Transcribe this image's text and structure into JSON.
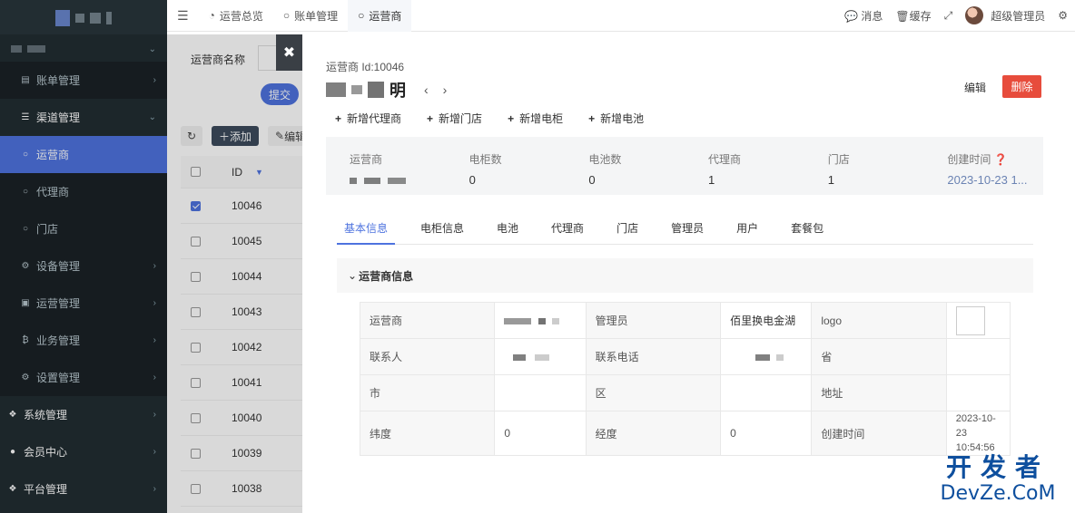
{
  "sidebar": {
    "items": [
      {
        "label": "账单管理",
        "icon": "file-icon",
        "level": "sub"
      },
      {
        "label": "渠道管理",
        "icon": "bars-icon",
        "level": "sub-open"
      },
      {
        "label": "运营商",
        "icon": "circle-icon",
        "level": "child-active"
      },
      {
        "label": "代理商",
        "icon": "circle-icon",
        "level": "child"
      },
      {
        "label": "门店",
        "icon": "circle-icon",
        "level": "child"
      },
      {
        "label": "设备管理",
        "icon": "gear-icon",
        "level": "sub"
      },
      {
        "label": "运营管理",
        "icon": "book-icon",
        "level": "sub"
      },
      {
        "label": "业务管理",
        "icon": "bitcoin-icon",
        "level": "sub"
      },
      {
        "label": "设置管理",
        "icon": "gears-icon",
        "level": "sub"
      },
      {
        "label": "系统管理",
        "icon": "cubes-icon",
        "level": "top"
      },
      {
        "label": "会员中心",
        "icon": "user-icon",
        "level": "top"
      },
      {
        "label": "平台管理",
        "icon": "cubes-icon",
        "level": "top"
      }
    ]
  },
  "topbar": {
    "tabs": [
      {
        "label": "运营总览"
      },
      {
        "label": "账单管理"
      },
      {
        "label": "运营商"
      }
    ],
    "message": "消息",
    "cache": "缓存",
    "username": "超级管理员"
  },
  "list": {
    "search_label": "运营商名称",
    "submit": "提交",
    "add": "添加",
    "edit": "编辑",
    "id_header": "ID",
    "rows": [
      "10046",
      "10045",
      "10044",
      "10043",
      "10042",
      "10041",
      "10040",
      "10039",
      "10038"
    ]
  },
  "drawer": {
    "subtitle": "运营商 Id:10046",
    "title_suffix": "明",
    "edit": "编辑",
    "delete": "删除",
    "actions": [
      "新增代理商",
      "新增门店",
      "新增电柜",
      "新增电池"
    ],
    "stats": [
      {
        "label": "运营商",
        "value": ""
      },
      {
        "label": "电柜数",
        "value": "0"
      },
      {
        "label": "电池数",
        "value": "0"
      },
      {
        "label": "代理商",
        "value": "1"
      },
      {
        "label": "门店",
        "value": "1"
      },
      {
        "label": "创建时间",
        "value": "2023-10-23 1..."
      }
    ],
    "tabs": [
      "基本信息",
      "电柜信息",
      "电池",
      "代理商",
      "门店",
      "管理员",
      "用户",
      "套餐包"
    ],
    "section_title": "运营商信息",
    "table": {
      "r1": {
        "l1": "运营商",
        "v1": "",
        "l2": "管理员",
        "v2": "佰里换电金湖",
        "l3": "logo"
      },
      "r2": {
        "l1": "联系人",
        "v1": "",
        "l2": "联系电话",
        "v2": "",
        "l3": "省"
      },
      "r3": {
        "l1": "市",
        "v1": "",
        "l2": "区",
        "v2": "",
        "l3": "地址"
      },
      "r4": {
        "l1": "纬度",
        "v1": "0",
        "l2": "经度",
        "v2": "0",
        "l3": "创建时间",
        "v3": "2023-10-23 10:54:56"
      }
    }
  },
  "watermark": {
    "line1": "开发者",
    "line2": "DevZe.CoM"
  }
}
